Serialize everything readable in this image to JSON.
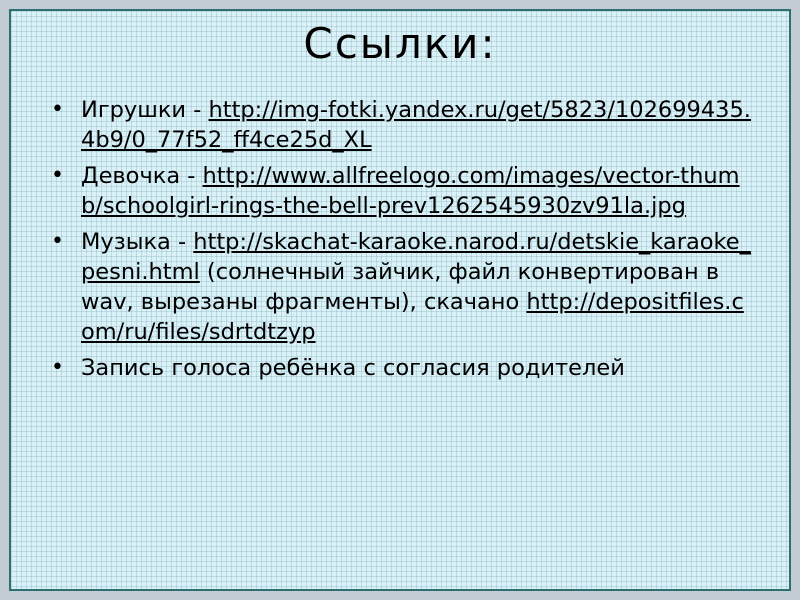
{
  "slide": {
    "title": "Ссылки:",
    "bullet_glyph": "•",
    "items": [
      {
        "label": "Игрушки - ",
        "link": "http://img-fotki.yandex.ru/get/5823/102699435.4b9/0_77f52_ff4ce25d_XL"
      },
      {
        "label": "Девочка - ",
        "link": "http://www.allfreelogo.com/images/vector-thumb/schoolgirl-rings-the-bell-prev1262545930zv91la.jpg"
      },
      {
        "label": "Музыка - ",
        "link": "http://skachat-karaoke.narod.ru/detskie_karaoke_pesni.html",
        "note": "  (солнечный зайчик, файл конвертирован в wav, вырезаны фрагменты), скачано ",
        "link2": "http://depositfiles.com/ru/files/sdrtdtzyp"
      },
      {
        "label": "Запись голоса ребёнка с согласия родителей"
      }
    ]
  }
}
